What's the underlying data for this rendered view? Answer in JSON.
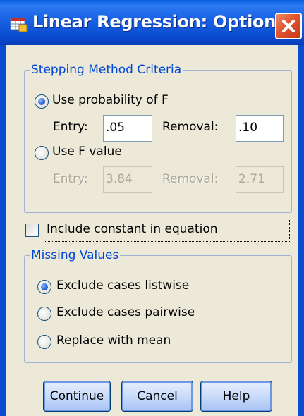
{
  "window": {
    "title": "Linear Regression: Options"
  },
  "stepping": {
    "legend": "Stepping Method Criteria",
    "use_probability_label": "Use probability of F",
    "use_probability_selected": true,
    "entry_label": "Entry:",
    "entry_value": ".05",
    "removal_label": "Removal:",
    "removal_value": ".10",
    "use_f_value_label": "Use F value",
    "use_f_value_selected": false,
    "f_entry_label": "Entry:",
    "f_entry_value": "3.84",
    "f_removal_label": "Removal:",
    "f_removal_value": "2.71"
  },
  "include_constant": {
    "label": "Include constant in equation",
    "checked": false
  },
  "missing": {
    "legend": "Missing Values",
    "options": [
      {
        "label": "Exclude cases listwise",
        "selected": true
      },
      {
        "label": "Exclude cases pairwise",
        "selected": false
      },
      {
        "label": "Replace with mean",
        "selected": false
      }
    ]
  },
  "buttons": {
    "continue": "Continue",
    "cancel": "Cancel",
    "help": "Help"
  },
  "colors": {
    "titlebar": "#0a4cd0",
    "dialog_bg": "#ece9d8",
    "group_legend": "#0046d5",
    "close": "#e0542e"
  },
  "icons": [
    "app-icon",
    "close-icon"
  ]
}
